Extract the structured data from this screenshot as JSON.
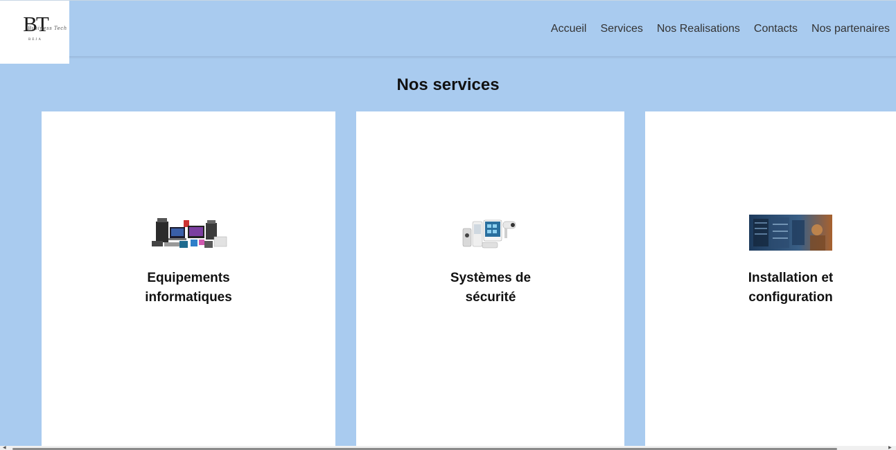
{
  "brand": {
    "letters": "BT",
    "script": "Business Tech",
    "sub": "BEJA"
  },
  "nav": {
    "items": [
      {
        "label": "Accueil"
      },
      {
        "label": "Services"
      },
      {
        "label": "Nos Realisations"
      },
      {
        "label": "Contacts"
      },
      {
        "label": "Nos partenaires"
      }
    ]
  },
  "services": {
    "title": "Nos services",
    "cards": [
      {
        "title": "Equipements informatiques",
        "image": "it-equipment-photo"
      },
      {
        "title": "Systèmes de sécurité",
        "image": "security-systems-photo"
      },
      {
        "title": "Installation et configuration",
        "image": "server-room-photo"
      }
    ]
  },
  "colors": {
    "background": "#a9cbef",
    "card": "#ffffff",
    "text": "#111111",
    "nav_text": "#333333"
  }
}
